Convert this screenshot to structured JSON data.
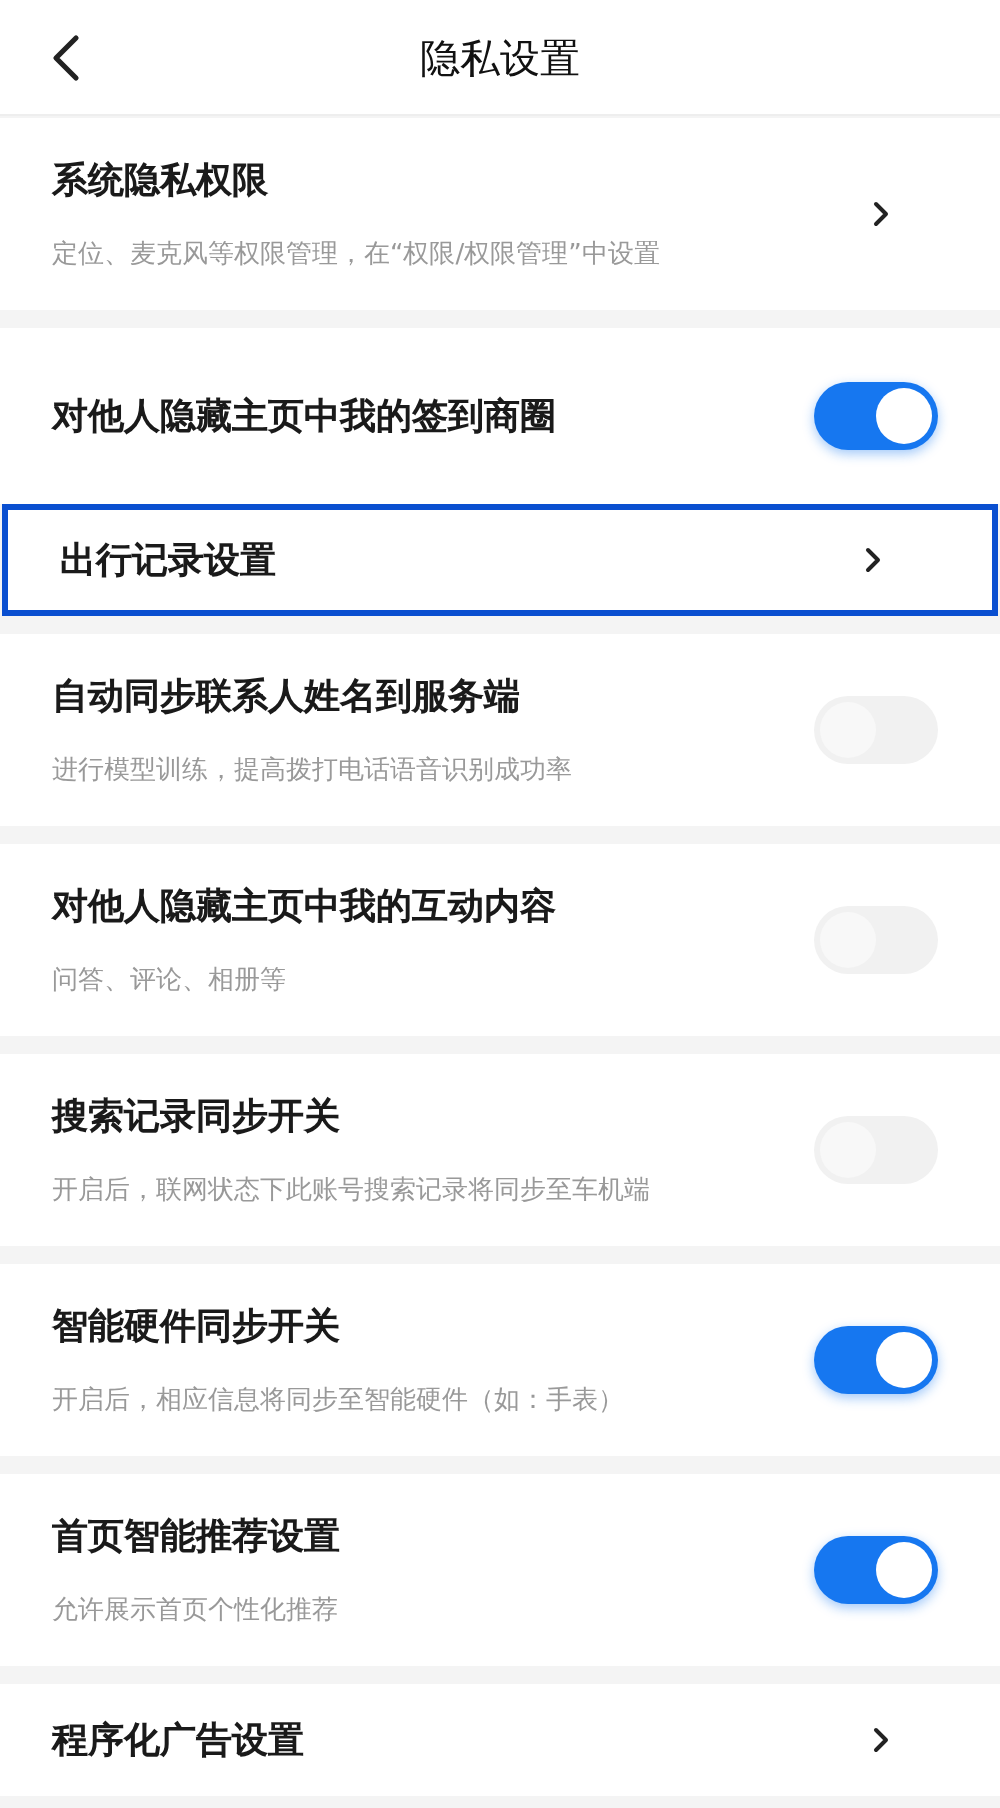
{
  "header": {
    "title": "隐私设置"
  },
  "items": [
    {
      "kind": "chevron",
      "title": "系统隐私权限",
      "subtitle": "定位、麦克风等权限管理，在“权限/权限管理”中设置",
      "highlighted": false
    },
    {
      "kind": "toggle",
      "title": "对他人隐藏主页中我的签到商圈",
      "on": true,
      "highlighted": false
    },
    {
      "kind": "chevron",
      "title": "出行记录设置",
      "highlighted": true
    },
    {
      "kind": "toggle",
      "title": "自动同步联系人姓名到服务端",
      "subtitle": "进行模型训练，提高拨打电话语音识别成功率",
      "on": false,
      "highlighted": false
    },
    {
      "kind": "toggle",
      "title": "对他人隐藏主页中我的互动内容",
      "subtitle": "问答、评论、相册等",
      "on": false,
      "highlighted": false
    },
    {
      "kind": "toggle",
      "title": "搜索记录同步开关",
      "subtitle": "开启后，联网状态下此账号搜索记录将同步至车机端",
      "on": false,
      "highlighted": false
    },
    {
      "kind": "toggle",
      "title": "智能硬件同步开关",
      "subtitle": "开启后，相应信息将同步至智能硬件（如：手表）",
      "on": true,
      "highlighted": false
    },
    {
      "kind": "toggle",
      "title": "首页智能推荐设置",
      "subtitle": "允许展示首页个性化推荐",
      "on": true,
      "highlighted": false
    },
    {
      "kind": "chevron",
      "title": "程序化广告设置",
      "highlighted": false
    }
  ]
}
